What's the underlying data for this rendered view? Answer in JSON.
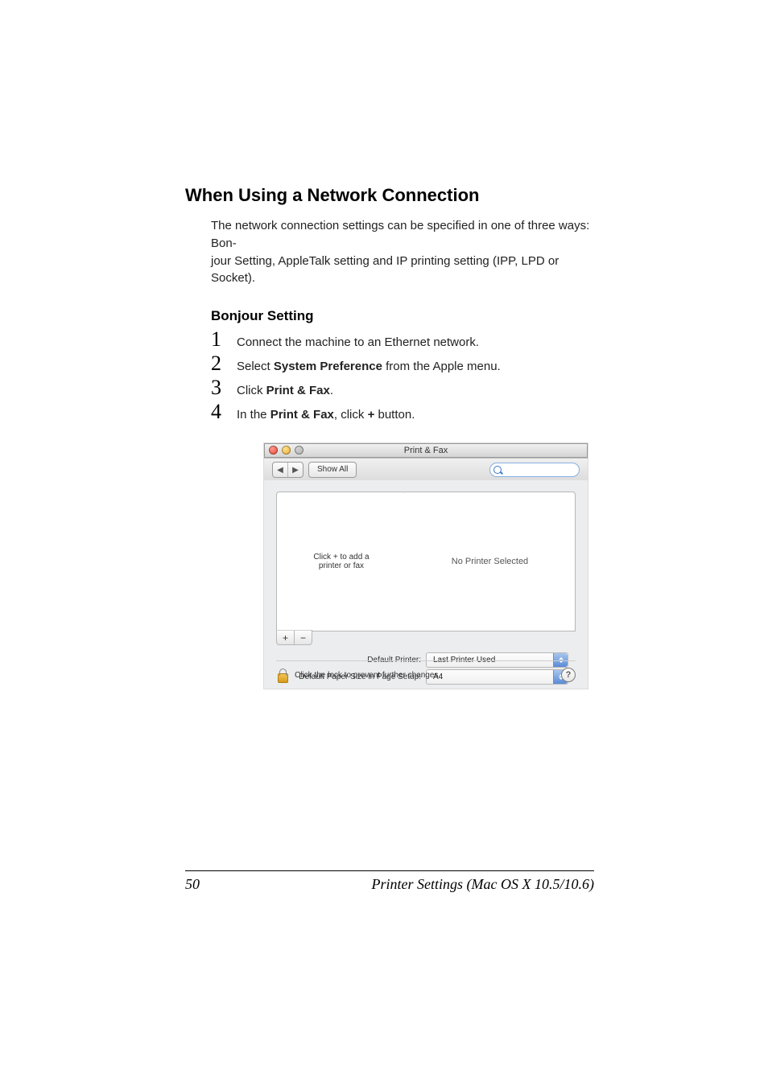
{
  "heading1": "When Using a Network Connection",
  "intro1": "The network connection settings can be specified in one of three ways: Bon-",
  "intro2": "jour Setting, AppleTalk setting and IP printing setting (IPP, LPD or Socket).",
  "heading2": "Bonjour Setting",
  "steps": {
    "s1": "Connect the machine to an Ethernet network.",
    "s2a": "Select ",
    "s2b": "System Preference",
    "s2c": " from the Apple menu.",
    "s3a": "Click ",
    "s3b": "Print & Fax",
    "s3c": ".",
    "s4a": "In the ",
    "s4b": "Print & Fax",
    "s4c": ", click ",
    "s4d": "+",
    "s4e": " button."
  },
  "window": {
    "title": "Print & Fax",
    "showall": "Show All",
    "list_hint1": "Click + to add a",
    "list_hint2": "printer or fax",
    "detail_msg": "No Printer Selected",
    "plus": "+",
    "minus": "−",
    "row1_label": "Default Printer:",
    "row1_value": "Last Printer Used",
    "row2_label": "Default Paper Size in Page Setup:",
    "row2_value": "A4",
    "lock_text": "Click the lock to prevent further changes.",
    "help": "?"
  },
  "footer": {
    "page": "50",
    "doc": "Printer Settings (Mac OS X 10.5/10.6)"
  }
}
